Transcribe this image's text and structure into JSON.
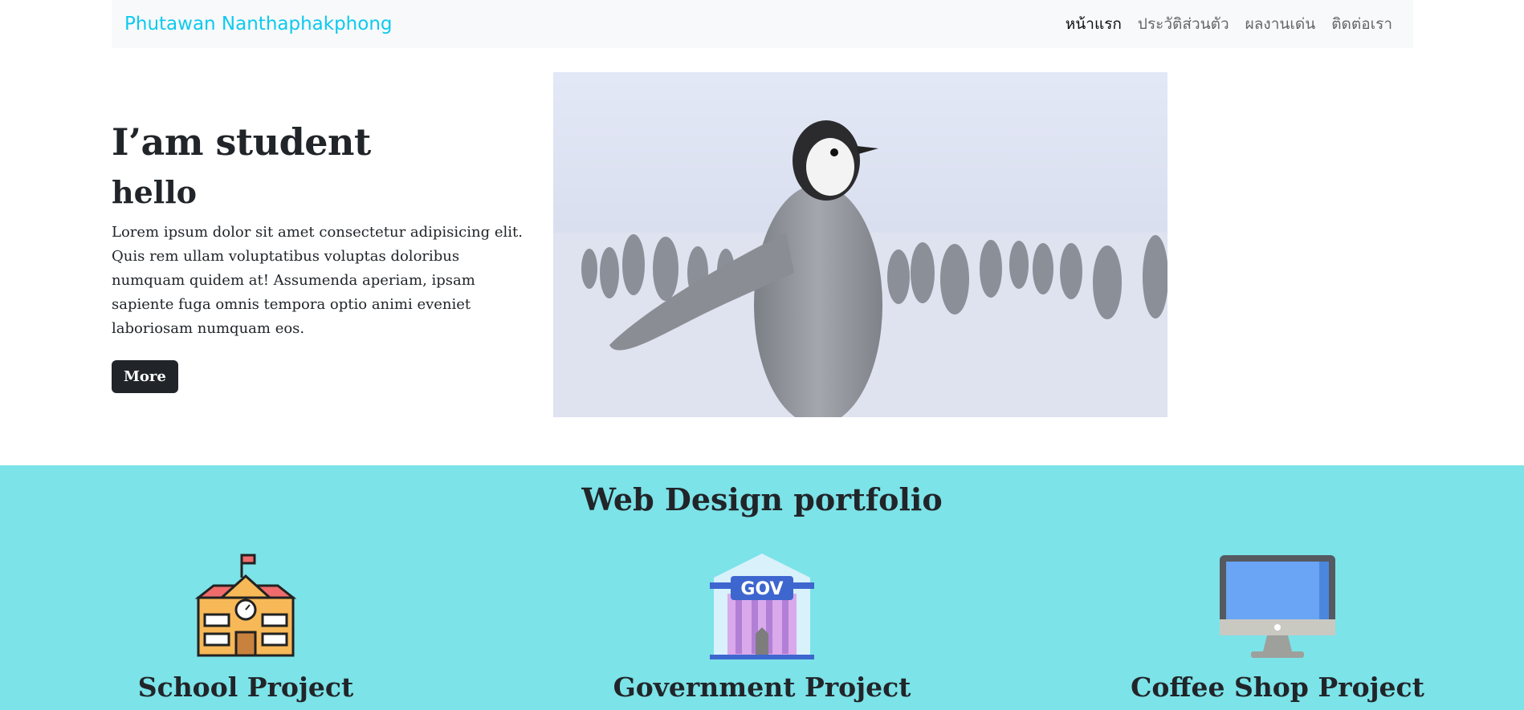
{
  "navbar": {
    "brand": "Phutawan Nanthaphakphong",
    "links": [
      {
        "label": "หน้าแรก",
        "active": true
      },
      {
        "label": "ประวัติส่วนตัว",
        "active": false
      },
      {
        "label": "ผลงานเด่น",
        "active": false
      },
      {
        "label": "ติดต่อเรา",
        "active": false
      }
    ]
  },
  "hero": {
    "title": "I’am student",
    "subtitle": "hello",
    "body": "Lorem ipsum dolor sit amet consectetur adipisicing elit. Quis rem ullam voluptatibus voluptas doloribus numquam quidem at! Assumenda aperiam, ipsam sapiente fuga omnis tempora optio animi eveniet laboriosam numquam eos.",
    "button": "More",
    "image": "penguin-photo"
  },
  "portfolio": {
    "title": "Web Design portfolio",
    "projects": [
      {
        "label": "School Project",
        "icon": "school-building-icon"
      },
      {
        "label": "Government Project",
        "icon": "government-building-icon"
      },
      {
        "label": "Coffee Shop Project",
        "icon": "computer-monitor-icon"
      }
    ]
  },
  "colors": {
    "brand": "#0dcaf0",
    "portfolio_bg": "#7ce3e8",
    "button_bg": "#212529"
  }
}
